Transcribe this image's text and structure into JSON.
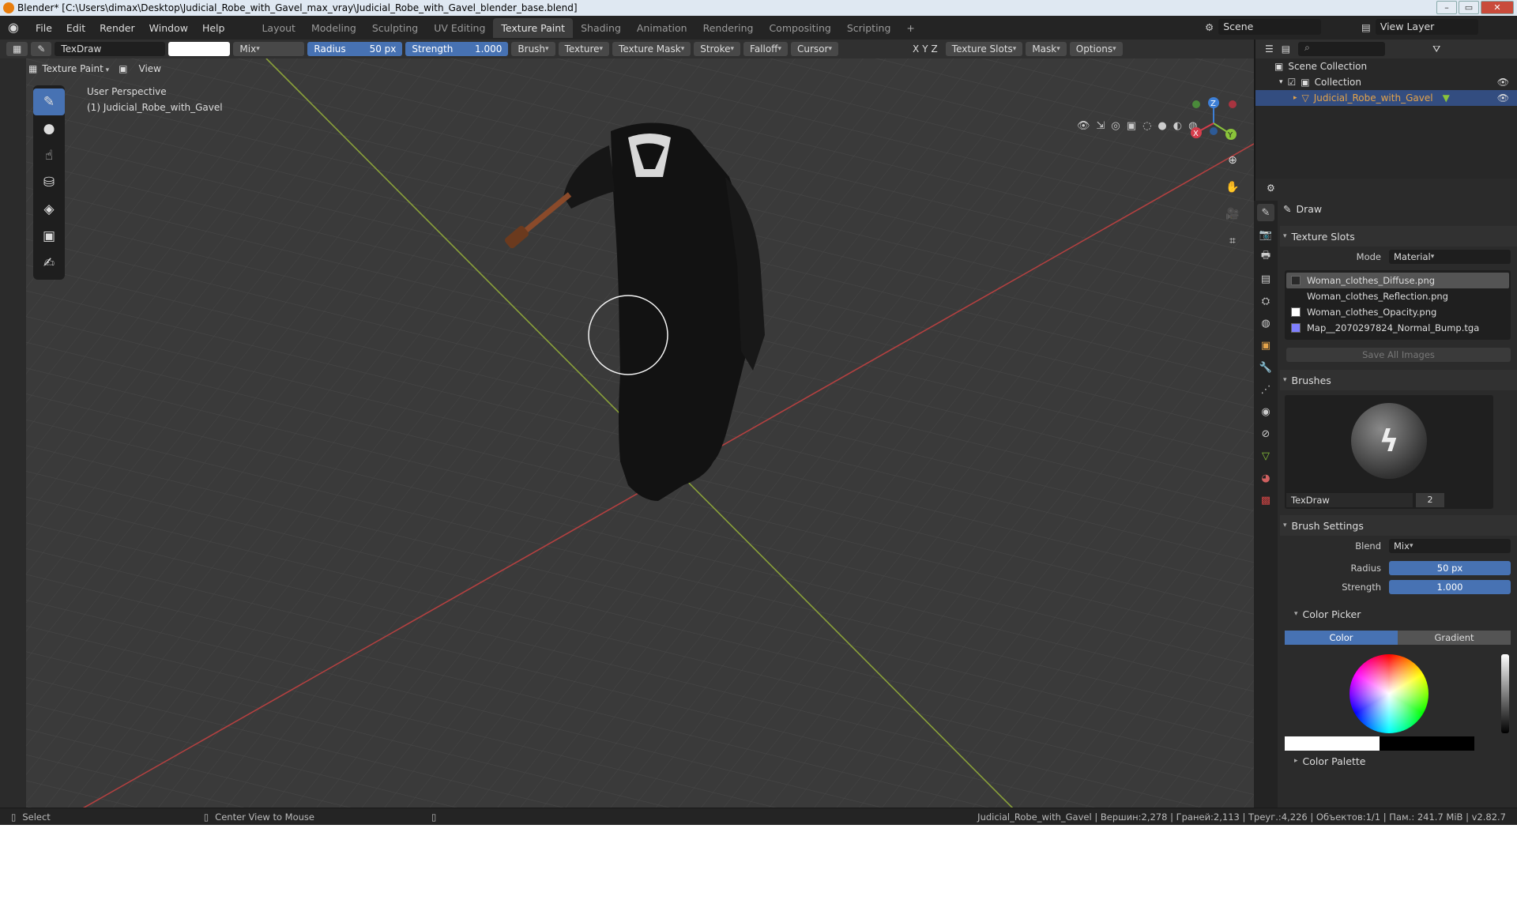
{
  "window": {
    "title": "Blender* [C:\\Users\\dimax\\Desktop\\Judicial_Robe_with_Gavel_max_vray\\Judicial_Robe_with_Gavel_blender_base.blend]"
  },
  "menu": {
    "items": [
      "File",
      "Edit",
      "Render",
      "Window",
      "Help"
    ]
  },
  "workspaces": [
    "Layout",
    "Modeling",
    "Sculpting",
    "UV Editing",
    "Texture Paint",
    "Shading",
    "Animation",
    "Rendering",
    "Compositing",
    "Scripting"
  ],
  "active_workspace": "Texture Paint",
  "scene": {
    "label": "Scene"
  },
  "view_layer": {
    "label": "View Layer"
  },
  "toolbar": {
    "brush_name": "TexDraw",
    "blend": "Mix",
    "radius_label": "Radius",
    "radius_value": "50 px",
    "strength_label": "Strength",
    "strength_value": "1.000",
    "menus": [
      "Brush",
      "Texture",
      "Texture Mask",
      "Stroke",
      "Falloff",
      "Cursor"
    ],
    "axis": [
      "X",
      "Y",
      "Z"
    ],
    "texture_slots": "Texture Slots",
    "mask": "Mask",
    "options": "Options"
  },
  "viewport_header": {
    "mode": "Texture Paint",
    "view": "View"
  },
  "viewport": {
    "perspective": "User Perspective",
    "object": "(1) Judicial_Robe_with_Gavel",
    "axis_gizmo": {
      "x": "X",
      "y": "Y",
      "z": "Z"
    }
  },
  "outliner": {
    "root": "Scene Collection",
    "collection": "Collection",
    "object": "Judicial_Robe_with_Gavel"
  },
  "properties": {
    "tool": "Draw",
    "texture_slots": {
      "header": "Texture Slots",
      "mode_label": "Mode",
      "mode_value": "Material",
      "items": [
        {
          "name": "Woman_clothes_Diffuse.png",
          "swatch": "#2a2a2a"
        },
        {
          "name": "Woman_clothes_Reflection.png",
          "swatch": "#1f1f1f"
        },
        {
          "name": "Woman_clothes_Opacity.png",
          "swatch": "#ffffff"
        },
        {
          "name": "Map__2070297824_Normal_Bump.tga",
          "swatch": "#8080ff"
        }
      ],
      "save_all": "Save All Images"
    },
    "brushes": {
      "header": "Brushes",
      "name": "TexDraw",
      "users": "2"
    },
    "brush_settings": {
      "header": "Brush Settings",
      "blend_label": "Blend",
      "blend_value": "Mix",
      "radius_label": "Radius",
      "radius_value": "50 px",
      "strength_label": "Strength",
      "strength_value": "1.000"
    },
    "color_picker": {
      "header": "Color Picker",
      "tab_color": "Color",
      "tab_gradient": "Gradient"
    },
    "color_palette": {
      "header": "Color Palette"
    }
  },
  "status": {
    "select": "Select",
    "center_view": "Center View to Mouse",
    "stats": "Judicial_Robe_with_Gavel | Вершин:2,278 | Граней:2,113 | Треуг.:4,226 | Объектов:1/1 | Пам.: 241.7 MiB | v2.82.7"
  },
  "colors": {
    "accent": "#4772b3",
    "selected_row": "#334d80",
    "object_orange": "#e4a34a"
  }
}
